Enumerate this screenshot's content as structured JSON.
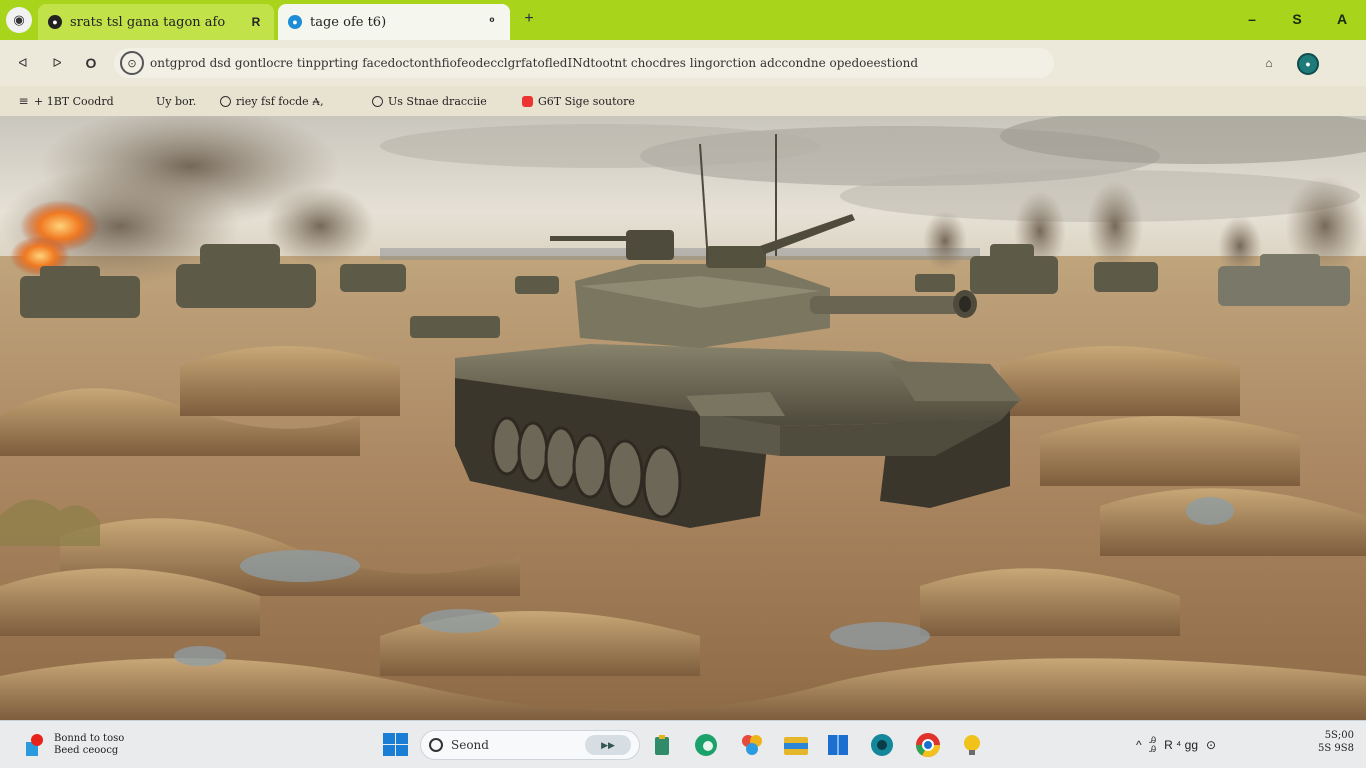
{
  "browser": {
    "tabs": [
      {
        "title": "srats tsl gana tagon afo",
        "close_label": "R"
      },
      {
        "title": "tage ofe t6)",
        "close_label": "⁰"
      }
    ],
    "new_tab_label": "+",
    "window_controls": {
      "minimize": "–",
      "maximize": "S",
      "close": "A"
    },
    "nav": {
      "back": "ᐊ",
      "forward": "ᐅ",
      "reload": "O"
    },
    "address": "ontgprod dsd gontlocre tinpprting facedoctonthfiofeodecclgrfatofledINdtootnt chocdres lingorction adccondne opedoeestiond",
    "bookmarks": [
      {
        "label": "+ 1BT Coodrd",
        "icon": "grid"
      },
      {
        "label": "Uy bor.",
        "icon": "none"
      },
      {
        "label": "riey fsf focde ₳,",
        "icon": "circle"
      },
      {
        "label": "Us Stnae dracciie",
        "icon": "circle"
      },
      {
        "label": "G6T Sige soutore",
        "icon": "red"
      }
    ]
  },
  "taskbar": {
    "widget": {
      "line1": "Bonnd to toso",
      "line2": "Beed ceoocg"
    },
    "search_placeholder": "Seond",
    "search_badge": "▶▶",
    "tray": {
      "chevron": "^",
      "lang": "Ꭿ\nᎯ",
      "status": "R ⁴ ɡg",
      "settings": "⊙"
    },
    "clock": {
      "time": "5S;00",
      "date": "5S 9S8"
    }
  },
  "colors": {
    "tab_strip": "#a8d51c",
    "active_tab": "#f5f7ee",
    "profile": "#1f7b7a",
    "sky": "#d9d5cb",
    "sand": "#b48a5a",
    "tank": "#6e6a58"
  }
}
